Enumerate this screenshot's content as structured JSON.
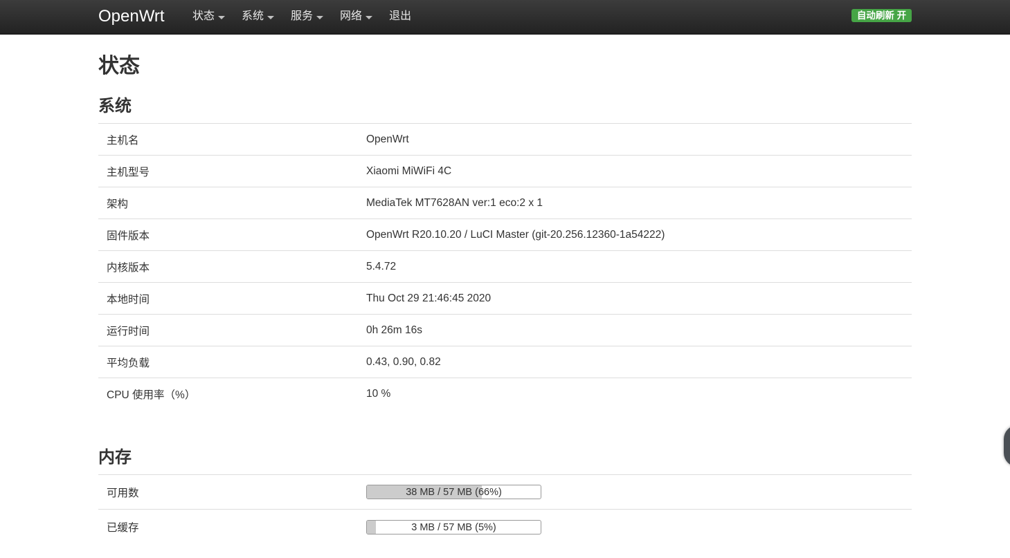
{
  "navbar": {
    "brand": "OpenWrt",
    "items": [
      {
        "label": "状态",
        "dropdown": true
      },
      {
        "label": "系统",
        "dropdown": true
      },
      {
        "label": "服务",
        "dropdown": true
      },
      {
        "label": "网络",
        "dropdown": true
      },
      {
        "label": "退出",
        "dropdown": false
      }
    ],
    "refresh_badge": "自动刷新 开"
  },
  "page": {
    "title": "状态"
  },
  "system": {
    "title": "系统",
    "rows": [
      {
        "label": "主机名",
        "value": "OpenWrt"
      },
      {
        "label": "主机型号",
        "value": "Xiaomi MiWiFi 4C"
      },
      {
        "label": "架构",
        "value": "MediaTek MT7628AN ver:1 eco:2 x 1"
      },
      {
        "label": "固件版本",
        "value": "OpenWrt R20.10.20 / LuCI Master (git-20.256.12360-1a54222)"
      },
      {
        "label": "内核版本",
        "value": "5.4.72"
      },
      {
        "label": "本地时间",
        "value": "Thu Oct 29 21:46:45 2020"
      },
      {
        "label": "运行时间",
        "value": "0h 26m 16s"
      },
      {
        "label": "平均负载",
        "value": "0.43, 0.90, 0.82"
      },
      {
        "label": "CPU 使用率（%）",
        "value": "10 %"
      }
    ]
  },
  "memory": {
    "title": "内存",
    "rows": [
      {
        "label": "可用数",
        "bar_text": "38 MB / 57 MB (66%)",
        "percent": 66
      },
      {
        "label": "已缓存",
        "bar_text": "3 MB / 57 MB (5%)",
        "percent": 5
      }
    ]
  },
  "colors": {
    "navbar_bg": "#222222",
    "badge_green": "#46a546",
    "progress_fill": "#cccccc"
  }
}
